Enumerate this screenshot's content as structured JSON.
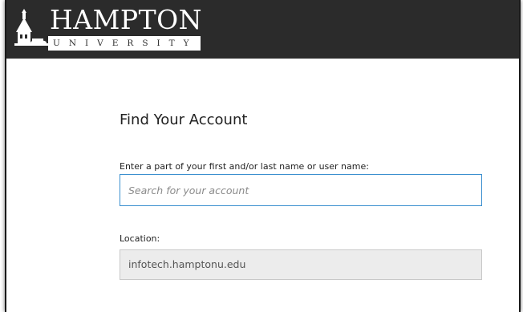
{
  "header": {
    "logo_wordmark": "HAMPTON",
    "logo_subtitle": "UNIVERSITY",
    "logo_icon": "hampton-clock-tower-icon"
  },
  "form": {
    "title": "Find Your Account",
    "search_label": "Enter a part of your first and/or last name or user name:",
    "search_placeholder": "Search for your account",
    "search_value": "",
    "location_label": "Location:",
    "location_value": "infotech.hamptonu.edu"
  },
  "colors": {
    "header_bg": "#2b2b2b",
    "input_focus_border": "#3a8fcf",
    "readonly_bg": "#ececec"
  }
}
